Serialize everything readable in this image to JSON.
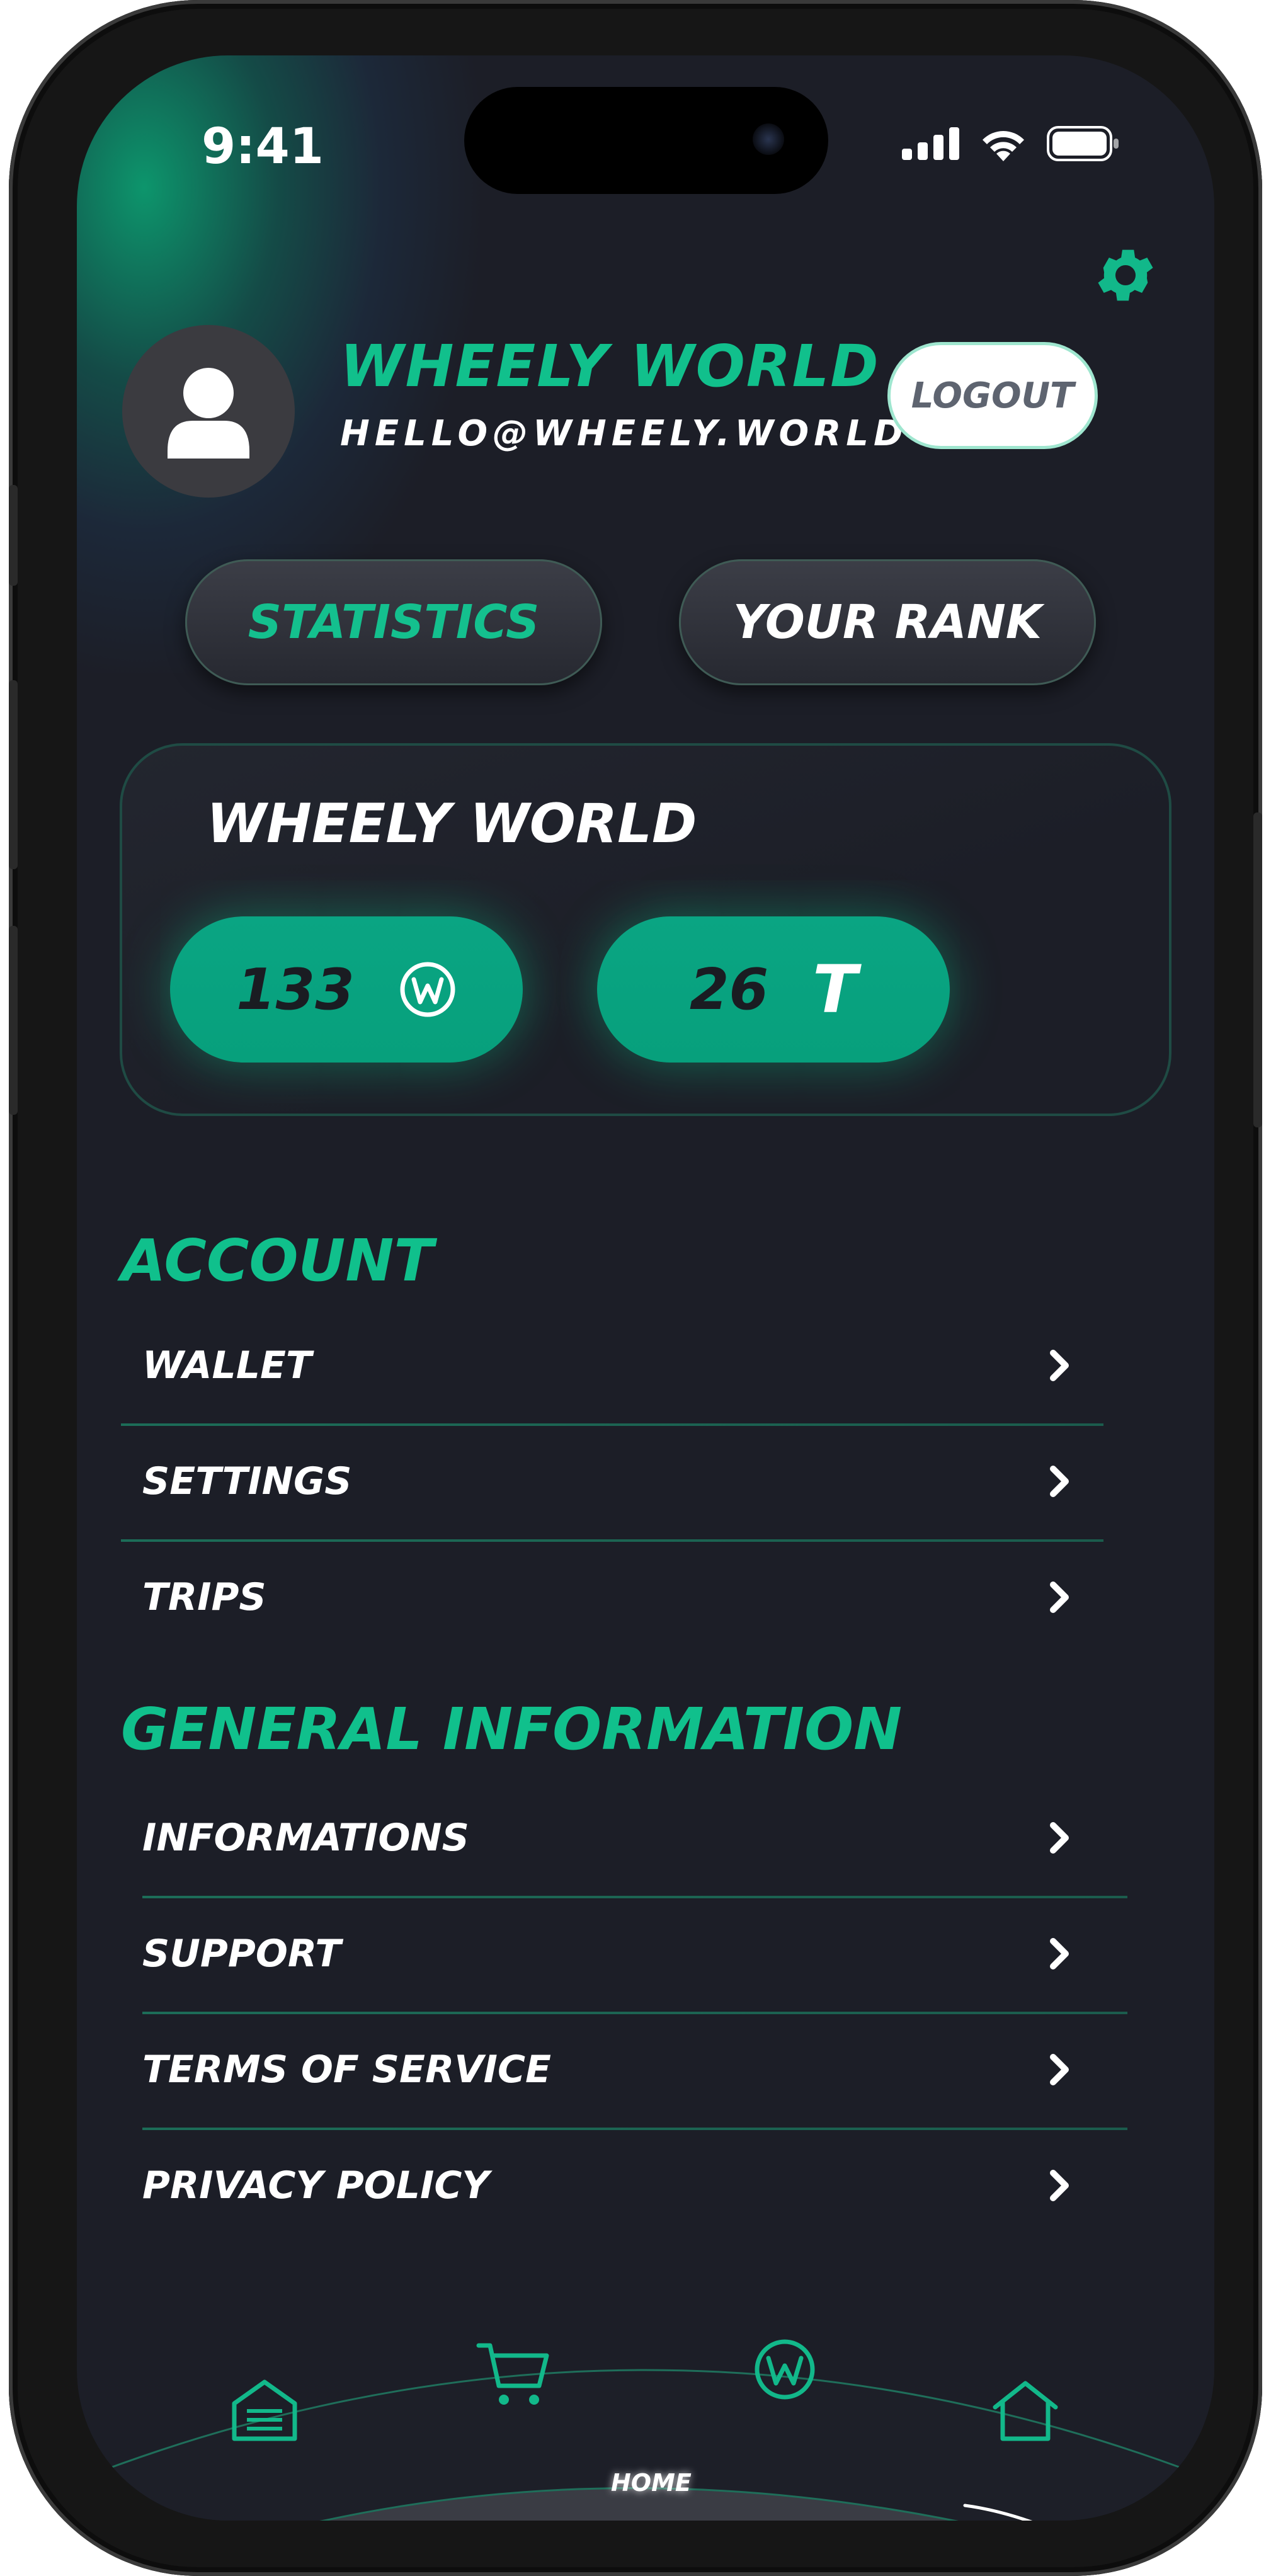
{
  "status_bar": {
    "time": "9:41"
  },
  "profile": {
    "name": "WHEELY WORLD",
    "email": "HELLO@WHEELY.WORLD",
    "logout_label": "LOGOUT"
  },
  "tabs": [
    {
      "label": "STATISTICS",
      "active": true
    },
    {
      "label": "YOUR RANK",
      "active": false
    }
  ],
  "summary_card": {
    "title": "WHEELY WORLD",
    "coins_value": "133",
    "coins_icon": "wheely-coin-icon",
    "trips_value": "26",
    "trips_unit": "T"
  },
  "account": {
    "title": "ACCOUNT",
    "items": [
      {
        "label": "WALLET"
      },
      {
        "label": "SETTINGS"
      },
      {
        "label": "TRIPS"
      }
    ]
  },
  "general_information": {
    "title": "GENERAL INFORMATION",
    "items": [
      {
        "label": "INFORMATIONS"
      },
      {
        "label": "SUPPORT"
      },
      {
        "label": "TERMS OF SERVICE"
      },
      {
        "label": "PRIVACY POLICY"
      }
    ]
  },
  "bottom_nav": {
    "items": [
      {
        "icon": "garage-icon"
      },
      {
        "icon": "cart-icon"
      },
      {
        "icon": "wheely-coin-icon"
      },
      {
        "icon": "home-icon"
      }
    ],
    "active_label": "HOME"
  },
  "colors": {
    "accent": "#10c08c",
    "background": "#1c1e27",
    "chip": "#07a07c"
  }
}
